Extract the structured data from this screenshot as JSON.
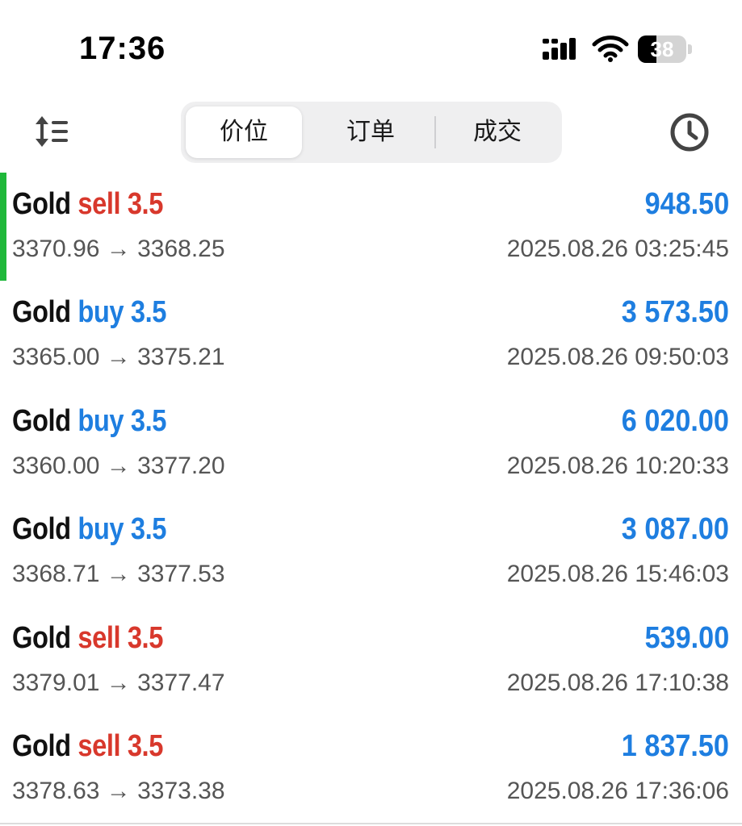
{
  "status_bar": {
    "time": "17:36",
    "battery_level": "38",
    "icons": [
      "signal-icon",
      "wifi-icon",
      "battery-icon"
    ]
  },
  "toolbar": {
    "sort_icon": "sort-lines-icon",
    "history_icon": "clock-icon",
    "tabs": [
      {
        "label": "价位",
        "active": true
      },
      {
        "label": "订单",
        "active": false
      },
      {
        "label": "成交",
        "active": false
      }
    ]
  },
  "colors": {
    "sell": "#d8382c",
    "buy": "#1e7ee0",
    "profit": "#1e7ee0",
    "marker": "#1fb83a"
  },
  "deals": [
    {
      "symbol": "Gold",
      "side": "sell",
      "volume": "3.5",
      "profit": "948.50",
      "prices": "3370.96 → 3368.25",
      "time": "2025.08.26 03:25:45",
      "selected": true
    },
    {
      "symbol": "Gold",
      "side": "buy",
      "volume": "3.5",
      "profit": "3 573.50",
      "prices": "3365.00 → 3375.21",
      "time": "2025.08.26 09:50:03",
      "selected": false
    },
    {
      "symbol": "Gold",
      "side": "buy",
      "volume": "3.5",
      "profit": "6 020.00",
      "prices": "3360.00 → 3377.20",
      "time": "2025.08.26 10:20:33",
      "selected": false
    },
    {
      "symbol": "Gold",
      "side": "buy",
      "volume": "3.5",
      "profit": "3 087.00",
      "prices": "3368.71 → 3377.53",
      "time": "2025.08.26 15:46:03",
      "selected": false
    },
    {
      "symbol": "Gold",
      "side": "sell",
      "volume": "3.5",
      "profit": "539.00",
      "prices": "3379.01 → 3377.47",
      "time": "2025.08.26 17:10:38",
      "selected": false
    },
    {
      "symbol": "Gold",
      "side": "sell",
      "volume": "3.5",
      "profit": "1 837.50",
      "prices": "3378.63 → 3373.38",
      "time": "2025.08.26 17:36:06",
      "selected": false
    }
  ]
}
